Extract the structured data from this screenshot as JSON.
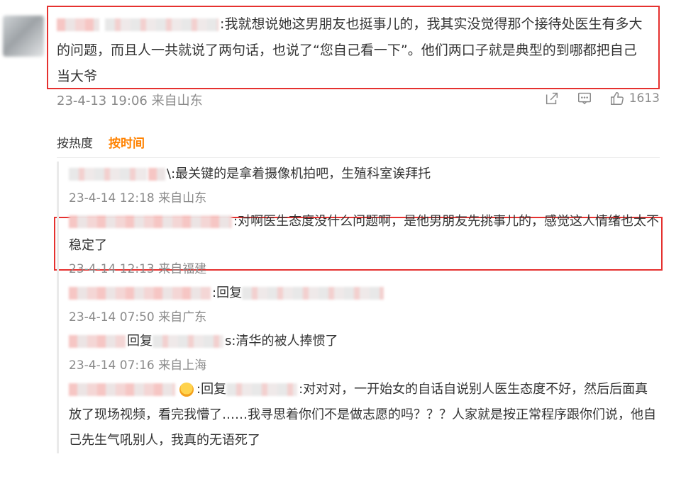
{
  "main": {
    "text": ":我就想说她这男朋友也挺事儿的，我其实没觉得那个接待处医生有多大的问题，而且人一共就说了两句话，也说了“您自己看一下”。他们两口子就是典型的到哪都把自己当大爷",
    "meta": "23-4-13 19:06 来自山东",
    "like_count": "1613"
  },
  "sort": {
    "hot": "按热度",
    "time": "按时间"
  },
  "replies": [
    {
      "tail": "\\:最关键的是拿着摄像机拍吧，生殖科室诶拜托",
      "meta": "23-4-14 12:18 来自山东"
    },
    {
      "tail": ":对啊医生态度没什么问题啊，是他男朋友先挑事儿的，感觉这人情绪也太不稳定了",
      "meta": "23-4-14 12:13 来自福建"
    },
    {
      "tail": ":回复",
      "meta": "23-4-14 07:50 来自广东"
    },
    {
      "mid": "回复",
      "tail": "s:清华的被人捧惯了",
      "meta": "23-4-14 07:16 来自上海"
    },
    {
      "mid": ":回复",
      "tail": ":对对对，一开始女的自话自说别人医生态度不好，然后后面真放了现场视频，看完我懵了……我寻思着你们不是做志愿的吗？？？人家就是按正常程序跟你们说，他自己先生气吼别人，我真的无语死了"
    }
  ]
}
